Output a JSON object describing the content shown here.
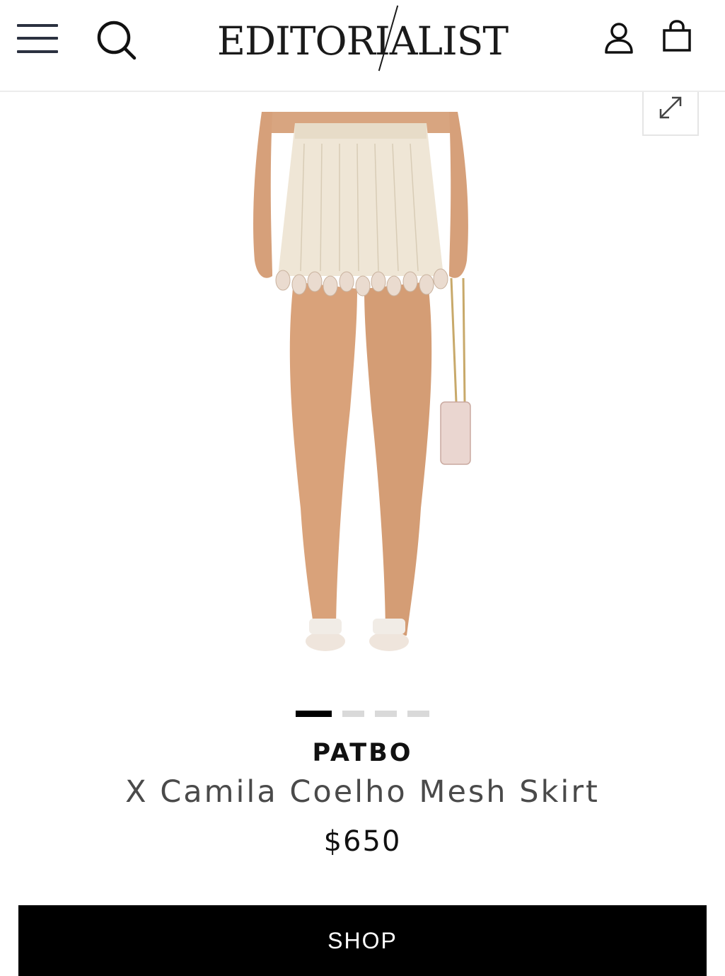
{
  "header": {
    "logo_text": "EDITORIALIST",
    "icons": {
      "menu": "hamburger-menu-icon",
      "search": "search-icon",
      "account": "user-account-icon",
      "bag": "shopping-bag-icon"
    }
  },
  "gallery": {
    "expand_icon": "expand-arrows-icon",
    "image_alt": "product-image",
    "slide_count": 4,
    "active_slide": 1
  },
  "product": {
    "brand": "PATBO",
    "title": "X Camila Coelho Mesh Skirt",
    "price": "$650"
  },
  "actions": {
    "shop_label": "SHOP"
  },
  "colors": {
    "accent": "#000000",
    "icon": "#2b3140",
    "inactive_dot": "#d9d9d9"
  }
}
